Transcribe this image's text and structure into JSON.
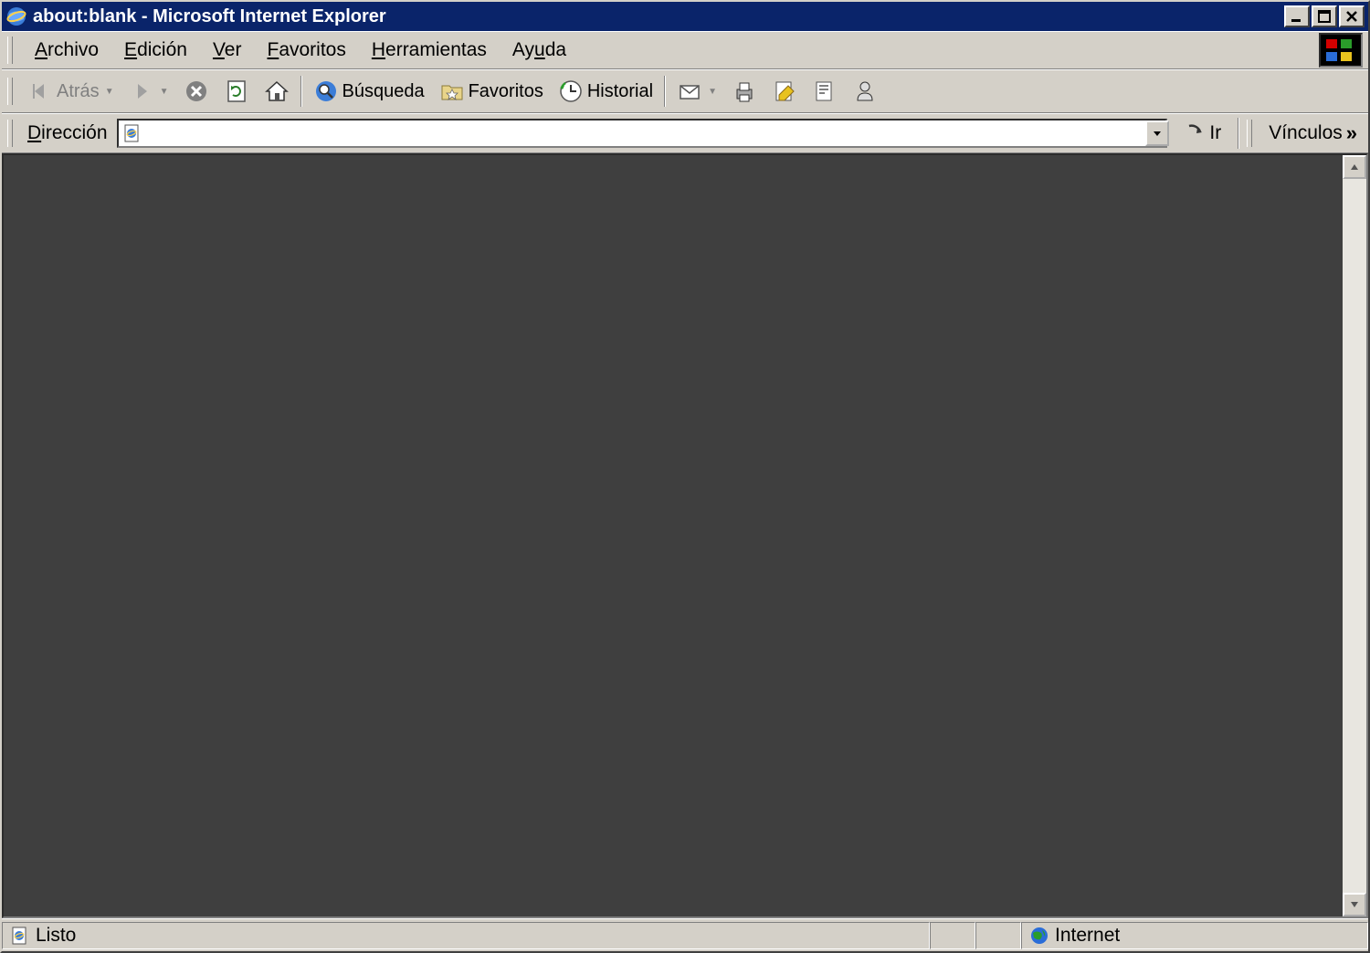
{
  "window": {
    "title": "about:blank - Microsoft Internet Explorer"
  },
  "menu": {
    "items": [
      {
        "label": "Archivo",
        "accel_index": 0
      },
      {
        "label": "Edición",
        "accel_index": 0
      },
      {
        "label": "Ver",
        "accel_index": 0
      },
      {
        "label": "Favoritos",
        "accel_index": 0
      },
      {
        "label": "Herramientas",
        "accel_index": 0
      },
      {
        "label": "Ayuda",
        "accel_index": 2
      }
    ]
  },
  "toolbar": {
    "back_label": "Atrás",
    "search_label": "Búsqueda",
    "favorites_label": "Favoritos",
    "history_label": "Historial"
  },
  "address": {
    "label": "Dirección",
    "value": "",
    "go_label": "Ir",
    "links_label": "Vínculos"
  },
  "status": {
    "ready": "Listo",
    "zone": "Internet"
  },
  "colors": {
    "titlebar": "#0a246a",
    "face": "#d4d0c8",
    "content_bg": "#3f3f3f"
  }
}
